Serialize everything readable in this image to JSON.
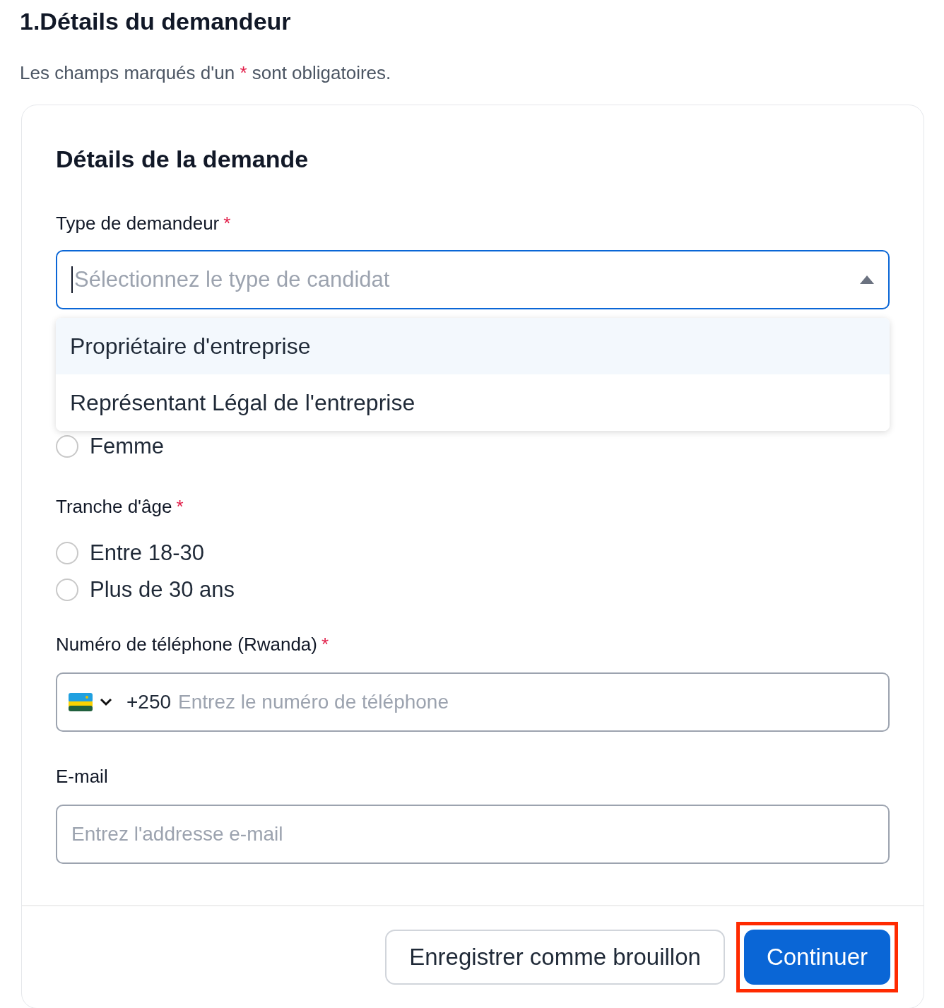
{
  "page_title": "1.Détails du demandeur",
  "note": {
    "before": "Les champs marqués d'un",
    "mark": "*",
    "after": "sont obligatoires."
  },
  "card": {
    "title": "Détails de la demande",
    "applicant_type": {
      "label": "Type de demandeur",
      "required_mark": "*",
      "placeholder": "Sélectionnez le type de candidat",
      "expanded": true,
      "options": [
        {
          "label": "Propriétaire d'entreprise",
          "selected": true
        },
        {
          "label": "Représentant Légal de l'entreprise",
          "selected": false
        }
      ]
    },
    "gender": {
      "options": [
        {
          "label": "Femme",
          "checked": false
        }
      ]
    },
    "age": {
      "label": "Tranche d'âge",
      "required_mark": "*",
      "options": [
        {
          "label": "Entre 18-30",
          "checked": false
        },
        {
          "label": "Plus de 30 ans",
          "checked": false
        }
      ]
    },
    "phone": {
      "label": "Numéro de téléphone (Rwanda)",
      "required_mark": "*",
      "dial_code": "+250",
      "placeholder": "Entrez le numéro de téléphone"
    },
    "email": {
      "label": "E-mail",
      "placeholder": "Entrez l'addresse e-mail"
    },
    "actions": [
      {
        "label": "Enregistrer comme brouillon",
        "kind": "secondary",
        "highlighted": false
      },
      {
        "label": "Continuer",
        "kind": "primary",
        "highlighted": true
      }
    ]
  }
}
